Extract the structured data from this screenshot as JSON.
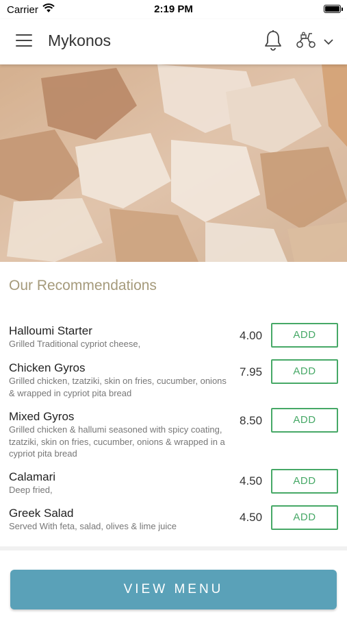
{
  "status_bar": {
    "carrier": "Carrier",
    "time": "2:19 PM",
    "battery_level": 1.0
  },
  "nav": {
    "title": "Mykonos",
    "icons": [
      "menu-icon",
      "bell-icon",
      "scooter-icon",
      "chevron-down-icon"
    ]
  },
  "hero": {
    "description": "chicken gyros meat photo"
  },
  "recommendations": {
    "title": "Our Recommendations",
    "add_label": "ADD",
    "items": [
      {
        "name": "Halloumi Starter",
        "description": "Grilled Traditional cypriot cheese,",
        "price": "4.00"
      },
      {
        "name": "Chicken Gyros",
        "description": "Grilled chicken, tzatziki, skin on fries, cucumber, onions &  wrapped in cypriot pita bread",
        "price": "7.95"
      },
      {
        "name": "Mixed Gyros",
        "description": "Grilled chicken & hallumi seasoned with spicy coating, tzatziki, skin on fries, cucumber, onions & wrapped in a cypriot pita bread",
        "price": "8.50"
      },
      {
        "name": "Calamari",
        "description": "Deep fried,",
        "price": "4.50"
      },
      {
        "name": "Greek Salad",
        "description": "Served With feta, salad, olives & lime juice",
        "price": "4.50"
      }
    ]
  },
  "footer": {
    "view_menu_label": "VIEW MENU"
  },
  "colors": {
    "accent_green": "#46a866",
    "button_teal": "#5aa1b8",
    "section_title": "#a59a7b"
  }
}
